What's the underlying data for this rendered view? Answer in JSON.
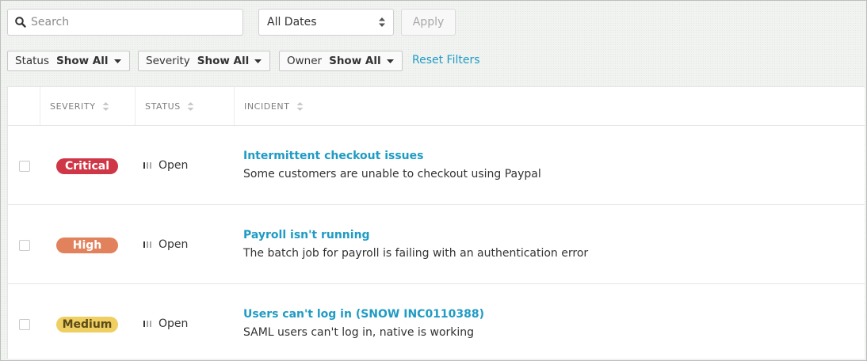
{
  "search": {
    "placeholder": "Search",
    "value": ""
  },
  "date_filter": {
    "selected": "All Dates"
  },
  "apply_label": "Apply",
  "filters": [
    {
      "label": "Status",
      "value": "Show All"
    },
    {
      "label": "Severity",
      "value": "Show All"
    },
    {
      "label": "Owner",
      "value": "Show All"
    }
  ],
  "reset_label": "Reset Filters",
  "table": {
    "columns": [
      "SEVERITY",
      "STATUS",
      "INCIDENT"
    ],
    "rows": [
      {
        "severity": "Critical",
        "severity_color": "#cf3646",
        "severity_text_color": "#ffffff",
        "status": "Open",
        "title": "Intermittent checkout issues",
        "description": "Some customers are unable to checkout using Paypal"
      },
      {
        "severity": "High",
        "severity_color": "#e2825d",
        "severity_text_color": "#ffffff",
        "status": "Open",
        "title": "Payroll isn't running",
        "description": "The batch job for payroll is failing with an authentication error"
      },
      {
        "severity": "Medium",
        "severity_color": "#efcf62",
        "severity_text_color": "#5b4a1a",
        "status": "Open",
        "title": "Users can't log in (SNOW INC0110388)",
        "description": "SAML users can't log in, native is working"
      }
    ]
  },
  "colors": {
    "link": "#1f9bc4"
  },
  "icons": [
    "search-icon",
    "up-down-arrows-icon",
    "caret-down-icon",
    "sort-arrows-icon",
    "status-bars-icon"
  ]
}
